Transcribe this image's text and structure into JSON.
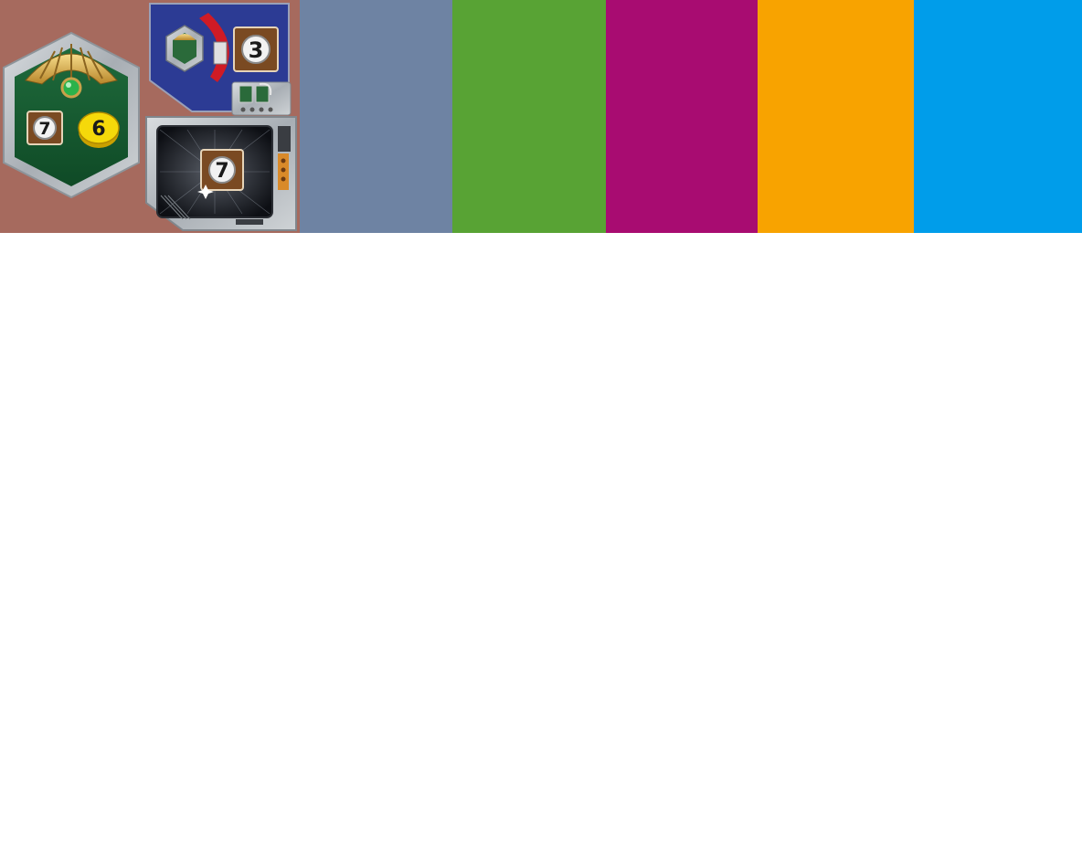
{
  "tiles": {
    "mission_cost": "7",
    "mission_reward": "6",
    "upgrade_cost": "3",
    "card_cost": "7"
  },
  "colors": {
    "art_background": "#a66a5e",
    "slate": "#6e83a3",
    "green": "#58a334",
    "magenta": "#a80c71",
    "orange": "#f8a300",
    "blue": "#009dea"
  },
  "icons": [
    "hex-mission-tile-icon",
    "gear-badge-icon",
    "coin-icon",
    "upgrade-panel-icon",
    "card-screen-icon"
  ]
}
